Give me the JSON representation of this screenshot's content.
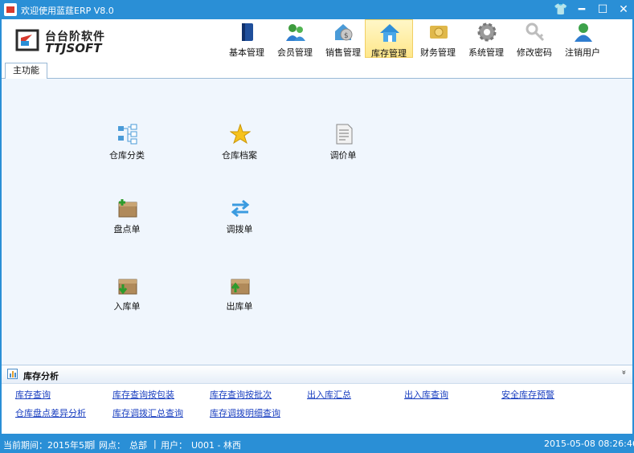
{
  "window": {
    "title": "欢迎使用蓝莛ERP V8.0",
    "controls": {
      "skin": "👕",
      "minimize": "━",
      "maximize": "☐",
      "close": "✕"
    }
  },
  "logo": {
    "cn": "台台阶软件",
    "en": "TTJSOFT"
  },
  "toolbar": {
    "items": [
      {
        "label": "基本管理",
        "icon": "book-icon"
      },
      {
        "label": "会员管理",
        "icon": "members-icon"
      },
      {
        "label": "销售管理",
        "icon": "sales-icon"
      },
      {
        "label": "库存管理",
        "icon": "home-icon",
        "active": true
      },
      {
        "label": "财务管理",
        "icon": "money-icon"
      },
      {
        "label": "系统管理",
        "icon": "gear-icon"
      },
      {
        "label": "修改密码",
        "icon": "key-icon"
      },
      {
        "label": "注销用户",
        "icon": "logout-user-icon"
      }
    ]
  },
  "tabs": {
    "main": "主功能"
  },
  "modules": {
    "warehouse_category": "仓库分类",
    "warehouse_archive": "仓库档案",
    "price_adjust": "调价单",
    "stocktake": "盘点单",
    "transfer": "调拨单",
    "inbound": "入库单",
    "outbound": "出库单"
  },
  "analysis": {
    "title": "库存分析",
    "collapse": "»",
    "row1": [
      "库存查询",
      "库存查询按包装",
      "库存查询按批次",
      "出入库汇总",
      "出入库查询",
      "安全库存预警"
    ],
    "row2": [
      "仓库盘点差异分析",
      "库存调拨汇总查询",
      "库存调拨明细查询"
    ]
  },
  "status": {
    "period_label": "当前期间：",
    "period_value": "2015年5期",
    "site_label": "网点：",
    "site_value": "总部",
    "user_label": "用户：",
    "user_value": "U001 - 林西",
    "datetime": "2015-05-08 08:26:46"
  },
  "colors": {
    "titlebar": "#2a8fd6",
    "content_bg": "#f0f6fd",
    "link": "#1a3fc0",
    "active_tab": "#ffe78a"
  }
}
